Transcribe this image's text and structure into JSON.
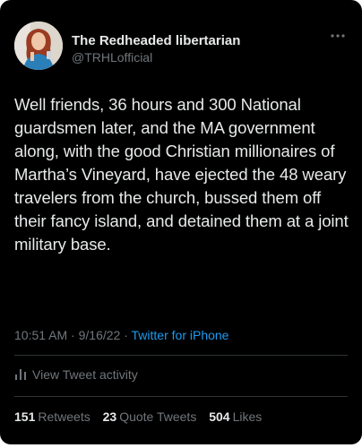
{
  "author": {
    "display_name": "The Redheaded libertarian",
    "handle": "@TRHLofficial"
  },
  "tweet": {
    "text": "Well friends, 36 hours and 300 National guardsmen later, and the MA government along, with the good Christian millionaires of Martha’s Vineyard, have ejected the 48 weary travelers from the church, bussed them off their fancy island, and detained them at a joint military base.",
    "time": "10:51 AM",
    "separator": "·",
    "date": "9/16/22",
    "source": "Twitter for iPhone"
  },
  "activity": {
    "label": "View Tweet activity",
    "icon": "bar-chart-icon"
  },
  "stats": {
    "retweets_count": "151",
    "retweets_label": "Retweets",
    "quotes_count": "23",
    "quotes_label": "Quote Tweets",
    "likes_count": "504",
    "likes_label": "Likes"
  },
  "colors": {
    "background": "#000000",
    "text": "#e7e9ea",
    "secondary": "#71767b",
    "link": "#1d9bf0",
    "divider": "#2f3336"
  }
}
